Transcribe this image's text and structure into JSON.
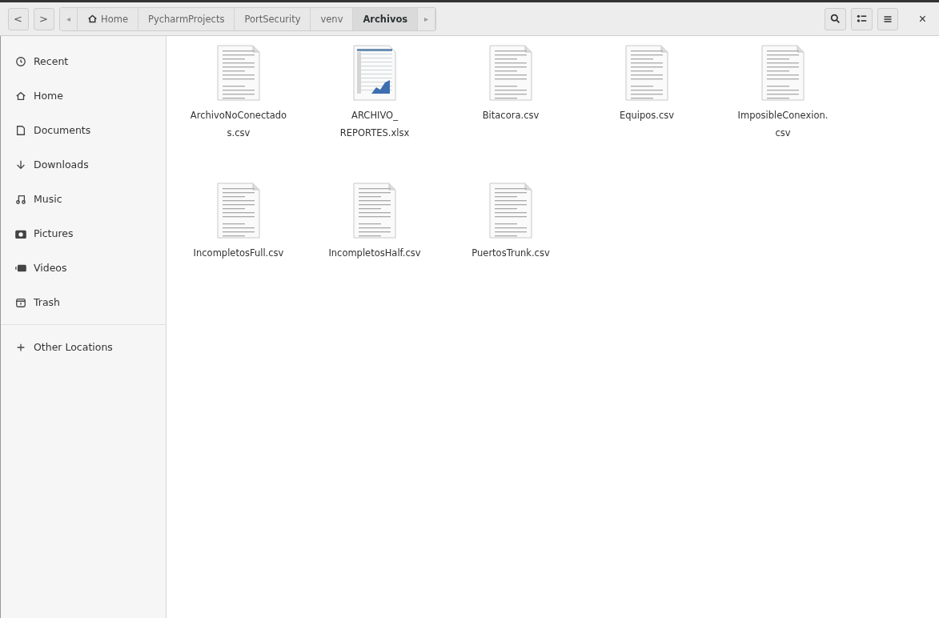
{
  "toolbar": {
    "back": "<",
    "forward": ">",
    "scroll_left": "◂",
    "scroll_right": "▸",
    "breadcrumbs": [
      {
        "label": "Home",
        "kind": "home",
        "selected": false
      },
      {
        "label": "PycharmProjects",
        "kind": "folder",
        "selected": false
      },
      {
        "label": "PortSecurity",
        "kind": "folder",
        "selected": false
      },
      {
        "label": "venv",
        "kind": "folder",
        "selected": false
      },
      {
        "label": "Archivos",
        "kind": "folder",
        "selected": true
      }
    ],
    "close": "×"
  },
  "sidebar": {
    "items": [
      {
        "label": "Recent",
        "kind": "recent"
      },
      {
        "label": "Home",
        "kind": "home"
      },
      {
        "label": "Documents",
        "kind": "documents"
      },
      {
        "label": "Downloads",
        "kind": "downloads"
      },
      {
        "label": "Music",
        "kind": "music"
      },
      {
        "label": "Pictures",
        "kind": "pictures"
      },
      {
        "label": "Videos",
        "kind": "videos"
      },
      {
        "label": "Trash",
        "kind": "trash"
      }
    ],
    "other": {
      "label": "Other Locations",
      "kind": "plus"
    }
  },
  "files": [
    {
      "lines": [
        "ArchivoNoConectado",
        "s.csv"
      ],
      "kind": "text"
    },
    {
      "lines": [
        "ARCHIVO_",
        "REPORTES.xlsx"
      ],
      "kind": "spreadsheet"
    },
    {
      "lines": [
        "Bitacora.csv"
      ],
      "kind": "text"
    },
    {
      "lines": [
        "Equipos.csv"
      ],
      "kind": "text"
    },
    {
      "lines": [
        "ImposibleConexion.",
        "csv"
      ],
      "kind": "text"
    },
    {
      "lines": [
        "IncompletosFull.csv"
      ],
      "kind": "text"
    },
    {
      "lines": [
        "IncompletosHalf.csv"
      ],
      "kind": "text"
    },
    {
      "lines": [
        "PuertosTrunk.csv"
      ],
      "kind": "text"
    }
  ]
}
